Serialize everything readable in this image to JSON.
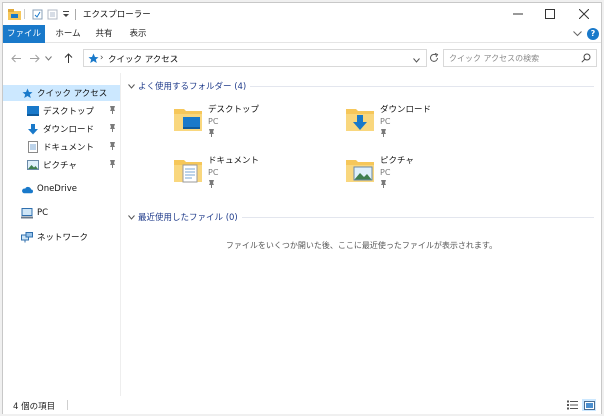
{
  "window": {
    "title": "エクスプローラー"
  },
  "ribbon": {
    "tabs": [
      "ファイル",
      "ホーム",
      "共有",
      "表示"
    ],
    "help_label": "?"
  },
  "navigation": {
    "address_separator": "›",
    "address_path": "クイック アクセス",
    "search_placeholder": "クイック アクセスの検索"
  },
  "sidebar": {
    "quick_access": "クイック アクセス",
    "pinned": [
      "デスクトップ",
      "ダウンロード",
      "ドキュメント",
      "ピクチャ"
    ],
    "onedrive": "OneDrive",
    "pc": "PC",
    "network": "ネットワーク"
  },
  "content": {
    "frequent_header": "よく使用するフォルダー (4)",
    "folders": [
      {
        "name": "デスクトップ",
        "location": "PC"
      },
      {
        "name": "ダウンロード",
        "location": "PC"
      },
      {
        "name": "ドキュメント",
        "location": "PC"
      },
      {
        "name": "ピクチャ",
        "location": "PC"
      }
    ],
    "recent_header": "最近使用したファイル (0)",
    "recent_empty": "ファイルをいくつか開いた後、ここに最近使ったファイルが表示されます。"
  },
  "status": {
    "item_count": "4 個の項目"
  },
  "colors": {
    "accent": "#1979ca",
    "folder": "#f6c75a",
    "selection": "#cce8ff",
    "section_text": "#1e3a8a"
  },
  "icons": [
    "app-folder-icon",
    "properties-icon",
    "new-folder-icon",
    "customize-qa-icon",
    "minimize-icon",
    "maximize-icon",
    "close-icon",
    "back-arrow-icon",
    "forward-arrow-icon",
    "recent-locations-icon",
    "up-arrow-icon",
    "quick-access-star-icon",
    "address-dropdown-icon",
    "refresh-icon",
    "search-icon",
    "desktop-icon",
    "download-icon",
    "document-icon",
    "picture-icon",
    "pin-icon",
    "onedrive-cloud-icon",
    "pc-icon",
    "network-icon",
    "details-view-icon",
    "large-icons-view-icon"
  ]
}
